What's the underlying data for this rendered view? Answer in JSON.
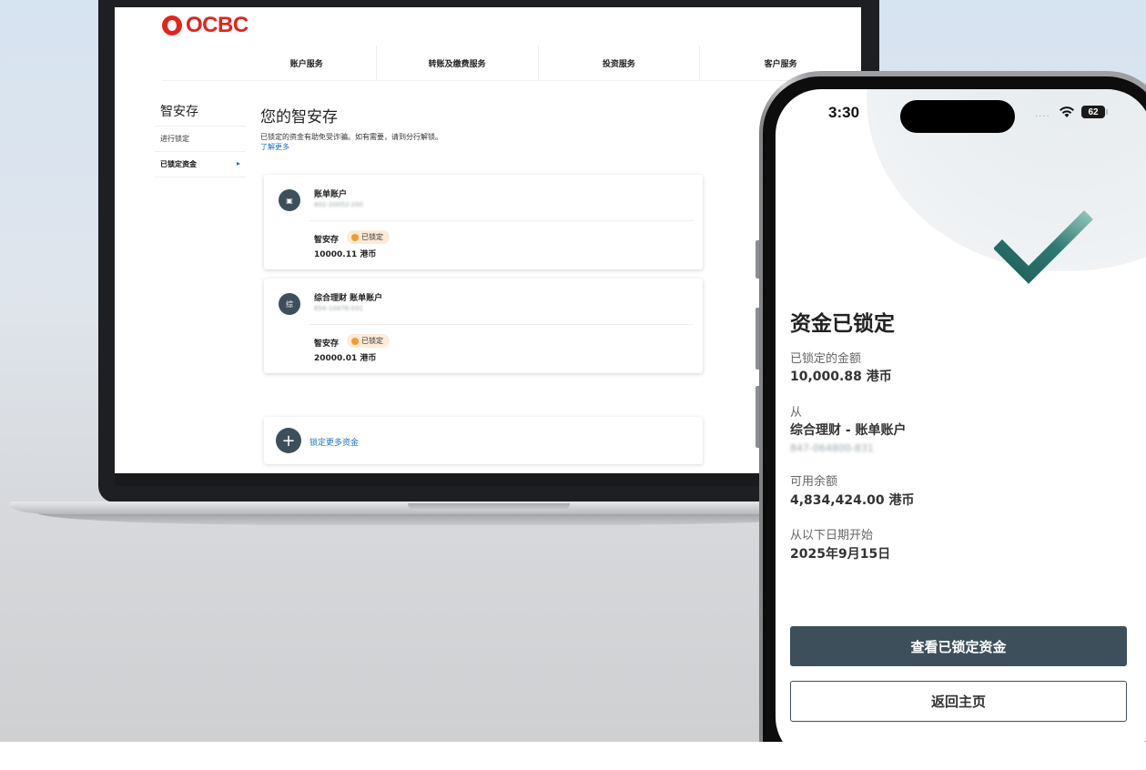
{
  "laptop": {
    "logo_text": "OCBC",
    "nav": [
      "账户服务",
      "转账及缴费服务",
      "投资服务",
      "客户服务"
    ],
    "sidebar": {
      "title": "智安存",
      "items": [
        {
          "label": "进行锁定"
        },
        {
          "label": "已锁定资金",
          "arrow": "▸"
        }
      ]
    },
    "main": {
      "title": "您的智安存",
      "description": "已锁定的资金有助免受诈骗。如有需要，请到分行解锁。",
      "learn_more": "了解更多",
      "cards": [
        {
          "icon": "▣",
          "account": "账单账户",
          "number": "602-20052-200",
          "product": "智安存",
          "badge": "已锁定",
          "amount": "10000.11 港币"
        },
        {
          "icon": "综",
          "account": "综合理财 账单账户",
          "number": "654-10476-031",
          "product": "智安存",
          "badge": "已锁定",
          "amount": "20000.01 港币"
        }
      ],
      "add_icon": "+",
      "add_label": "锁定更多资金"
    }
  },
  "phone": {
    "status": {
      "time": "3:30",
      "signal": "....",
      "battery": "62"
    },
    "title": "资金已锁定",
    "fields": [
      {
        "label": "已锁定的金额",
        "value": "10,000.88 港币"
      },
      {
        "label": "从",
        "value": "综合理财 - 账单账户",
        "sub": "847-064800-831"
      },
      {
        "label": "可用余额",
        "value": "4,834,424.00 港币"
      },
      {
        "label": "从以下日期开始",
        "value": "2025年9月15日"
      }
    ],
    "primary_button": "查看已锁定资金",
    "secondary_button": "返回主页"
  },
  "colors": {
    "brand_red": "#e1251b",
    "button_dark": "#3d4f5a",
    "link_blue": "#1a73c8",
    "badge_orange": "#f39b2d",
    "check_green": "#1f5f5b"
  }
}
